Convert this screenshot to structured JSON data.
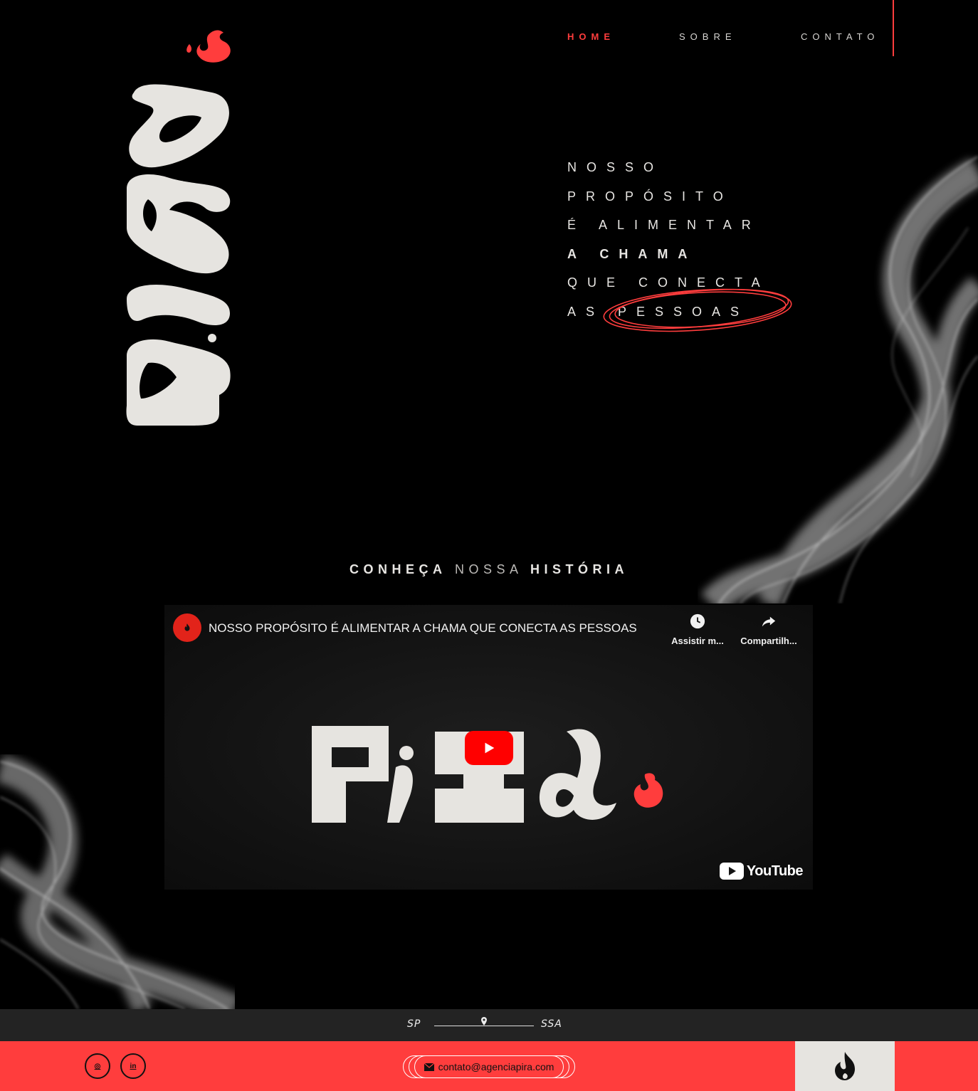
{
  "nav": {
    "items": [
      {
        "label": "HOME",
        "active": true
      },
      {
        "label": "SOBRE",
        "active": false
      },
      {
        "label": "CONTATO",
        "active": false
      }
    ],
    "accent_color": "#ff3d3d"
  },
  "brand": {
    "logo_text": "PIRA",
    "logo_icon": "flame-icon"
  },
  "hero": {
    "lines": [
      "NOSSO",
      "PROPÓSITO",
      "É ALIMENTAR",
      "A CHAMA",
      "QUE CONECTA",
      "AS"
    ],
    "highlight": "PESSOAS"
  },
  "story": {
    "part1": "CONHEÇA",
    "part2": "NOSSA",
    "part3": "HISTÓRIA"
  },
  "video": {
    "title": "NOSSO PROPÓSITO É ALIMENTAR A CHAMA QUE CONECTA AS PESSOAS",
    "watch_later": "Assistir m...",
    "share": "Compartilh...",
    "platform": "YouTube",
    "play_icon": "play-icon"
  },
  "locations": {
    "from": "SP",
    "to": "SSA"
  },
  "footer": {
    "email": "contato@agenciapira.com",
    "social": [
      {
        "icon": "instagram-icon",
        "label": "◎"
      },
      {
        "icon": "linkedin-icon",
        "label": "in"
      }
    ],
    "background": "#ff3d3d"
  }
}
